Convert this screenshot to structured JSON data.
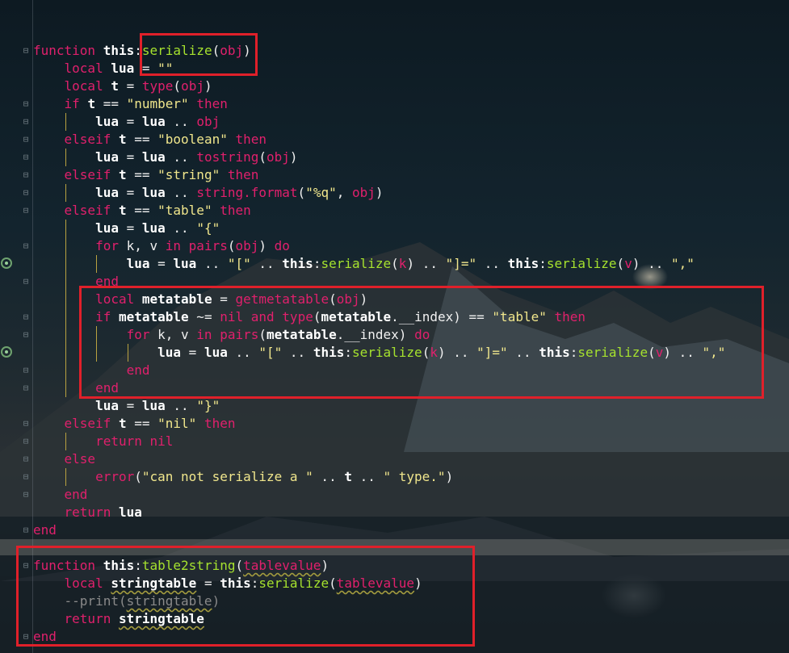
{
  "editor": {
    "language": "lua",
    "colors": {
      "keyword": "#e0206c",
      "function_name": "#a6e22e",
      "string": "#f0e68c",
      "identifier": "#ffffff",
      "comment": "#8a8a8a",
      "highlight_box": "#e0202a"
    },
    "lines": [
      [
        {
          "t": "function",
          "c": "kw"
        },
        {
          "t": " "
        },
        {
          "t": "this",
          "c": "id"
        },
        {
          "t": ":"
        },
        {
          "t": "serialize",
          "c": "fn"
        },
        {
          "t": "("
        },
        {
          "t": "obj",
          "c": "param"
        },
        {
          "t": ")"
        }
      ],
      [
        {
          "t": "    "
        },
        {
          "t": "local",
          "c": "kw"
        },
        {
          "t": " "
        },
        {
          "t": "lua",
          "c": "id"
        },
        {
          "t": " = "
        },
        {
          "t": "\"\"",
          "c": "str"
        }
      ],
      [
        {
          "t": "    "
        },
        {
          "t": "local",
          "c": "kw"
        },
        {
          "t": " "
        },
        {
          "t": "t",
          "c": "id"
        },
        {
          "t": " = "
        },
        {
          "t": "type",
          "c": "bi"
        },
        {
          "t": "("
        },
        {
          "t": "obj",
          "c": "param"
        },
        {
          "t": ")"
        }
      ],
      [
        {
          "t": "    "
        },
        {
          "t": "if",
          "c": "kw"
        },
        {
          "t": " "
        },
        {
          "t": "t",
          "c": "id"
        },
        {
          "t": " == "
        },
        {
          "t": "\"number\"",
          "c": "str"
        },
        {
          "t": " "
        },
        {
          "t": "then",
          "c": "kw"
        }
      ],
      [
        {
          "t": "        "
        },
        {
          "t": "lua",
          "c": "id"
        },
        {
          "t": " = "
        },
        {
          "t": "lua",
          "c": "id"
        },
        {
          "t": " .. "
        },
        {
          "t": "obj",
          "c": "param"
        }
      ],
      [
        {
          "t": "    "
        },
        {
          "t": "elseif",
          "c": "kw"
        },
        {
          "t": " "
        },
        {
          "t": "t",
          "c": "id"
        },
        {
          "t": " == "
        },
        {
          "t": "\"boolean\"",
          "c": "str"
        },
        {
          "t": " "
        },
        {
          "t": "then",
          "c": "kw"
        }
      ],
      [
        {
          "t": "        "
        },
        {
          "t": "lua",
          "c": "id"
        },
        {
          "t": " = "
        },
        {
          "t": "lua",
          "c": "id"
        },
        {
          "t": " .. "
        },
        {
          "t": "tostring",
          "c": "bi"
        },
        {
          "t": "("
        },
        {
          "t": "obj",
          "c": "param"
        },
        {
          "t": ")"
        }
      ],
      [
        {
          "t": "    "
        },
        {
          "t": "elseif",
          "c": "kw"
        },
        {
          "t": " "
        },
        {
          "t": "t",
          "c": "id"
        },
        {
          "t": " == "
        },
        {
          "t": "\"string\"",
          "c": "str"
        },
        {
          "t": " "
        },
        {
          "t": "then",
          "c": "kw"
        }
      ],
      [
        {
          "t": "        "
        },
        {
          "t": "lua",
          "c": "id"
        },
        {
          "t": " = "
        },
        {
          "t": "lua",
          "c": "id"
        },
        {
          "t": " .. "
        },
        {
          "t": "string.format",
          "c": "bi"
        },
        {
          "t": "("
        },
        {
          "t": "\"%q\"",
          "c": "str"
        },
        {
          "t": ", "
        },
        {
          "t": "obj",
          "c": "param"
        },
        {
          "t": ")"
        }
      ],
      [
        {
          "t": "    "
        },
        {
          "t": "elseif",
          "c": "kw"
        },
        {
          "t": " "
        },
        {
          "t": "t",
          "c": "id"
        },
        {
          "t": " == "
        },
        {
          "t": "\"table\"",
          "c": "str"
        },
        {
          "t": " "
        },
        {
          "t": "then",
          "c": "kw"
        }
      ],
      [
        {
          "t": "        "
        },
        {
          "t": "lua",
          "c": "id"
        },
        {
          "t": " = "
        },
        {
          "t": "lua",
          "c": "id"
        },
        {
          "t": " .. "
        },
        {
          "t": "\"{\"",
          "c": "str"
        }
      ],
      [
        {
          "t": "        "
        },
        {
          "t": "for",
          "c": "kw"
        },
        {
          "t": " k, v "
        },
        {
          "t": "in",
          "c": "kw"
        },
        {
          "t": " "
        },
        {
          "t": "pairs",
          "c": "bi"
        },
        {
          "t": "("
        },
        {
          "t": "obj",
          "c": "param"
        },
        {
          "t": ") "
        },
        {
          "t": "do",
          "c": "kw"
        }
      ],
      [
        {
          "t": "            "
        },
        {
          "t": "lua",
          "c": "id"
        },
        {
          "t": " = "
        },
        {
          "t": "lua",
          "c": "id"
        },
        {
          "t": " .. "
        },
        {
          "t": "\"[\"",
          "c": "str"
        },
        {
          "t": " .. "
        },
        {
          "t": "this",
          "c": "id"
        },
        {
          "t": ":"
        },
        {
          "t": "serialize",
          "c": "fn"
        },
        {
          "t": "("
        },
        {
          "t": "k",
          "c": "param"
        },
        {
          "t": ") .. "
        },
        {
          "t": "\"]=\"",
          "c": "str"
        },
        {
          "t": " .. "
        },
        {
          "t": "this",
          "c": "id"
        },
        {
          "t": ":"
        },
        {
          "t": "serialize",
          "c": "fn"
        },
        {
          "t": "("
        },
        {
          "t": "v",
          "c": "param"
        },
        {
          "t": ") .. "
        },
        {
          "t": "\",\"",
          "c": "str"
        }
      ],
      [
        {
          "t": "        "
        },
        {
          "t": "end",
          "c": "kw"
        }
      ],
      [
        {
          "t": "        "
        },
        {
          "t": "local",
          "c": "kw"
        },
        {
          "t": " "
        },
        {
          "t": "metatable",
          "c": "id"
        },
        {
          "t": " = "
        },
        {
          "t": "getmetatable",
          "c": "bi"
        },
        {
          "t": "("
        },
        {
          "t": "obj",
          "c": "param"
        },
        {
          "t": ")"
        }
      ],
      [
        {
          "t": "        "
        },
        {
          "t": "if",
          "c": "kw"
        },
        {
          "t": " "
        },
        {
          "t": "metatable",
          "c": "id"
        },
        {
          "t": " ~= "
        },
        {
          "t": "nil",
          "c": "kw"
        },
        {
          "t": " "
        },
        {
          "t": "and",
          "c": "kw"
        },
        {
          "t": " "
        },
        {
          "t": "type",
          "c": "bi"
        },
        {
          "t": "("
        },
        {
          "t": "metatable",
          "c": "id"
        },
        {
          "t": "."
        },
        {
          "t": "__index",
          "c": "tx"
        },
        {
          "t": ") == "
        },
        {
          "t": "\"table\"",
          "c": "str"
        },
        {
          "t": " "
        },
        {
          "t": "then",
          "c": "kw"
        }
      ],
      [
        {
          "t": "            "
        },
        {
          "t": "for",
          "c": "kw"
        },
        {
          "t": " k, v "
        },
        {
          "t": "in",
          "c": "kw"
        },
        {
          "t": " "
        },
        {
          "t": "pairs",
          "c": "bi"
        },
        {
          "t": "("
        },
        {
          "t": "metatable",
          "c": "id"
        },
        {
          "t": "."
        },
        {
          "t": "__index",
          "c": "tx"
        },
        {
          "t": ") "
        },
        {
          "t": "do",
          "c": "kw"
        }
      ],
      [
        {
          "t": "                "
        },
        {
          "t": "lua",
          "c": "id"
        },
        {
          "t": " = "
        },
        {
          "t": "lua",
          "c": "id"
        },
        {
          "t": " .. "
        },
        {
          "t": "\"[\"",
          "c": "str"
        },
        {
          "t": " .. "
        },
        {
          "t": "this",
          "c": "id"
        },
        {
          "t": ":"
        },
        {
          "t": "serialize",
          "c": "fn"
        },
        {
          "t": "("
        },
        {
          "t": "k",
          "c": "param"
        },
        {
          "t": ") .. "
        },
        {
          "t": "\"]=\"",
          "c": "str"
        },
        {
          "t": " .. "
        },
        {
          "t": "this",
          "c": "id"
        },
        {
          "t": ":"
        },
        {
          "t": "serialize",
          "c": "fn"
        },
        {
          "t": "("
        },
        {
          "t": "v",
          "c": "param"
        },
        {
          "t": ") .. "
        },
        {
          "t": "\",\"",
          "c": "str"
        }
      ],
      [
        {
          "t": "            "
        },
        {
          "t": "end",
          "c": "kw"
        }
      ],
      [
        {
          "t": "        "
        },
        {
          "t": "end",
          "c": "kw"
        }
      ],
      [
        {
          "t": "        "
        },
        {
          "t": "lua",
          "c": "id"
        },
        {
          "t": " = "
        },
        {
          "t": "lua",
          "c": "id"
        },
        {
          "t": " .. "
        },
        {
          "t": "\"}\"",
          "c": "str"
        }
      ],
      [
        {
          "t": "    "
        },
        {
          "t": "elseif",
          "c": "kw"
        },
        {
          "t": " "
        },
        {
          "t": "t",
          "c": "id"
        },
        {
          "t": " == "
        },
        {
          "t": "\"nil\"",
          "c": "str"
        },
        {
          "t": " "
        },
        {
          "t": "then",
          "c": "kw"
        }
      ],
      [
        {
          "t": "        "
        },
        {
          "t": "return",
          "c": "kw"
        },
        {
          "t": " "
        },
        {
          "t": "nil",
          "c": "kw"
        }
      ],
      [
        {
          "t": "    "
        },
        {
          "t": "else",
          "c": "kw"
        }
      ],
      [
        {
          "t": "        "
        },
        {
          "t": "error",
          "c": "bi"
        },
        {
          "t": "("
        },
        {
          "t": "\"can not serialize a \"",
          "c": "str"
        },
        {
          "t": " .. "
        },
        {
          "t": "t",
          "c": "id"
        },
        {
          "t": " .. "
        },
        {
          "t": "\" type.\"",
          "c": "str"
        },
        {
          "t": ")"
        }
      ],
      [
        {
          "t": "    "
        },
        {
          "t": "end",
          "c": "kw"
        }
      ],
      [
        {
          "t": "    "
        },
        {
          "t": "return",
          "c": "kw"
        },
        {
          "t": " "
        },
        {
          "t": "lua",
          "c": "id"
        }
      ],
      [
        {
          "t": "end",
          "c": "kw"
        }
      ],
      [],
      [
        {
          "t": "function",
          "c": "kw"
        },
        {
          "t": " "
        },
        {
          "t": "this",
          "c": "id"
        },
        {
          "t": ":"
        },
        {
          "t": "table2string",
          "c": "fn"
        },
        {
          "t": "("
        },
        {
          "t": "tablevalue",
          "c": "param",
          "w": true
        },
        {
          "t": ")"
        }
      ],
      [
        {
          "t": "    "
        },
        {
          "t": "local",
          "c": "kw"
        },
        {
          "t": " "
        },
        {
          "t": "stringtable",
          "c": "id",
          "w": true
        },
        {
          "t": " = "
        },
        {
          "t": "this",
          "c": "id"
        },
        {
          "t": ":"
        },
        {
          "t": "serialize",
          "c": "fn"
        },
        {
          "t": "("
        },
        {
          "t": "tablevalue",
          "c": "param",
          "w": true
        },
        {
          "t": ")"
        }
      ],
      [
        {
          "t": "    "
        },
        {
          "t": "--print(",
          "c": "cm"
        },
        {
          "t": "stringtable",
          "c": "cm",
          "w": true
        },
        {
          "t": ")",
          "c": "cm"
        }
      ],
      [
        {
          "t": "    "
        },
        {
          "t": "return",
          "c": "kw"
        },
        {
          "t": " "
        },
        {
          "t": "stringtable",
          "c": "id",
          "w": true
        }
      ],
      [
        {
          "t": "end",
          "c": "kw"
        }
      ]
    ]
  }
}
